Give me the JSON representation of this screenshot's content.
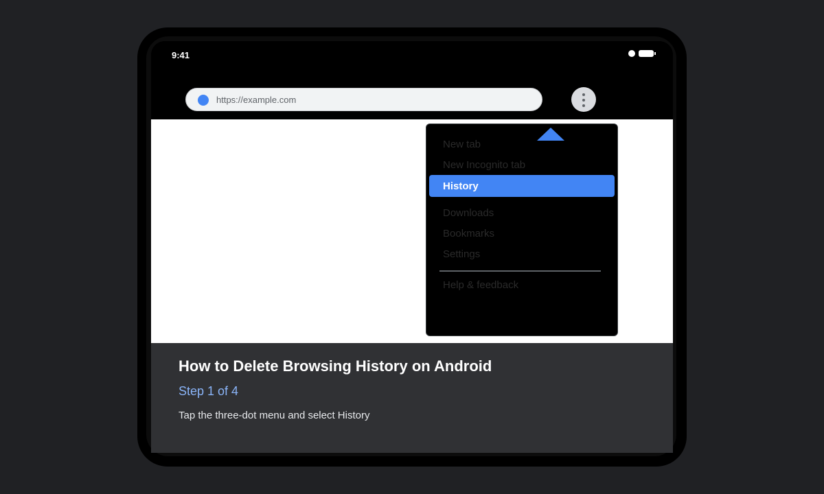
{
  "status_bar": {
    "time": "9:41"
  },
  "browser": {
    "url": "https://example.com",
    "menu_button_icon": "more-vert-icon"
  },
  "menu": {
    "items": [
      {
        "label": "New tab"
      },
      {
        "label": "New Incognito tab"
      },
      {
        "label": "History",
        "highlighted": true
      },
      {
        "label": "Downloads"
      },
      {
        "label": "Bookmarks"
      },
      {
        "label": "Settings"
      },
      {
        "label": "Help & feedback"
      }
    ],
    "pointer_icon": "pointer-arrow-icon"
  },
  "tutorial": {
    "title": "How to Delete Browsing History on Android",
    "step": "Step 1 of 4",
    "description": "Tap the three-dot menu and select History"
  },
  "colors": {
    "accent": "#4285f4",
    "step_text": "#8ab4f8",
    "caption_background": "#303134",
    "page_background": "#202124"
  }
}
